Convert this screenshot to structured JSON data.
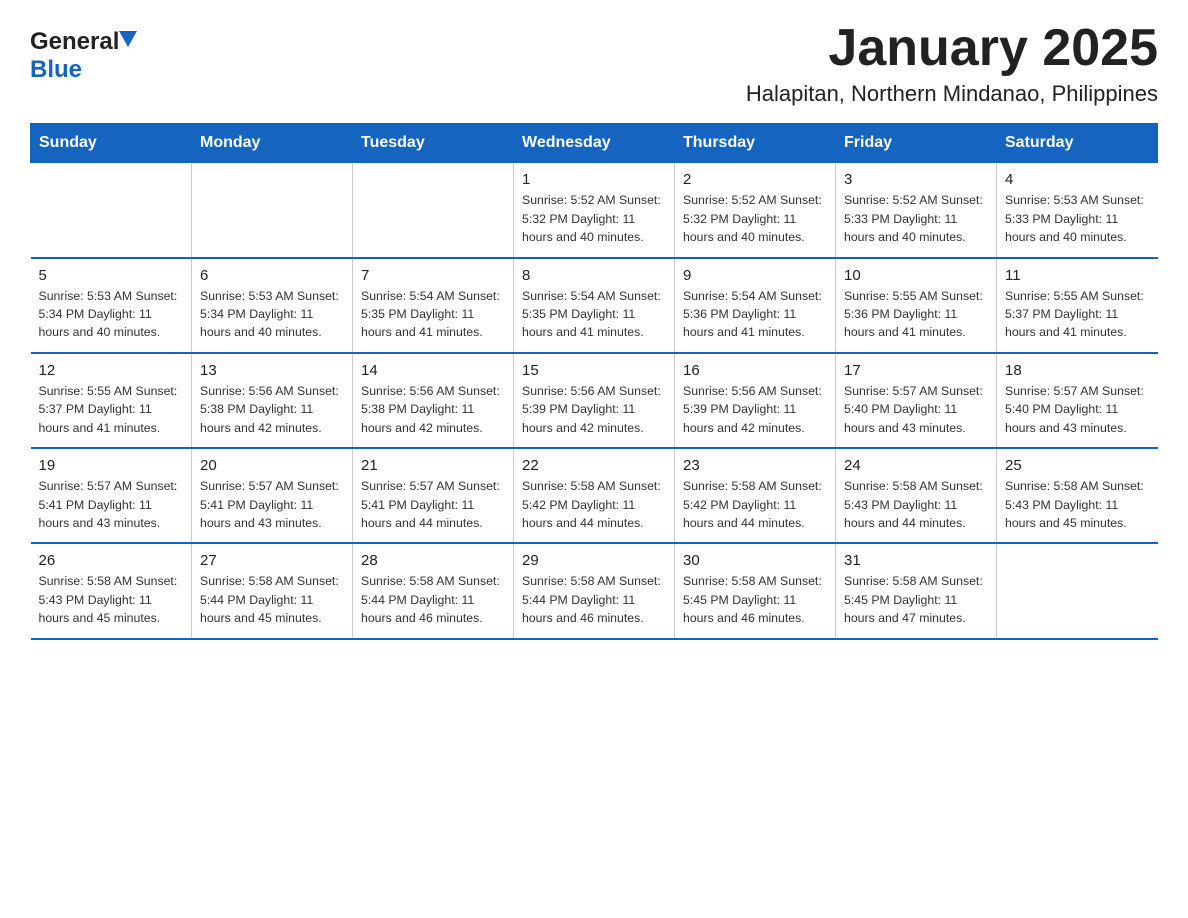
{
  "logo": {
    "general": "General",
    "blue": "Blue"
  },
  "title": "January 2025",
  "subtitle": "Halapitan, Northern Mindanao, Philippines",
  "days_of_week": [
    "Sunday",
    "Monday",
    "Tuesday",
    "Wednesday",
    "Thursday",
    "Friday",
    "Saturday"
  ],
  "weeks": [
    [
      {
        "day": "",
        "info": ""
      },
      {
        "day": "",
        "info": ""
      },
      {
        "day": "",
        "info": ""
      },
      {
        "day": "1",
        "info": "Sunrise: 5:52 AM\nSunset: 5:32 PM\nDaylight: 11 hours and 40 minutes."
      },
      {
        "day": "2",
        "info": "Sunrise: 5:52 AM\nSunset: 5:32 PM\nDaylight: 11 hours and 40 minutes."
      },
      {
        "day": "3",
        "info": "Sunrise: 5:52 AM\nSunset: 5:33 PM\nDaylight: 11 hours and 40 minutes."
      },
      {
        "day": "4",
        "info": "Sunrise: 5:53 AM\nSunset: 5:33 PM\nDaylight: 11 hours and 40 minutes."
      }
    ],
    [
      {
        "day": "5",
        "info": "Sunrise: 5:53 AM\nSunset: 5:34 PM\nDaylight: 11 hours and 40 minutes."
      },
      {
        "day": "6",
        "info": "Sunrise: 5:53 AM\nSunset: 5:34 PM\nDaylight: 11 hours and 40 minutes."
      },
      {
        "day": "7",
        "info": "Sunrise: 5:54 AM\nSunset: 5:35 PM\nDaylight: 11 hours and 41 minutes."
      },
      {
        "day": "8",
        "info": "Sunrise: 5:54 AM\nSunset: 5:35 PM\nDaylight: 11 hours and 41 minutes."
      },
      {
        "day": "9",
        "info": "Sunrise: 5:54 AM\nSunset: 5:36 PM\nDaylight: 11 hours and 41 minutes."
      },
      {
        "day": "10",
        "info": "Sunrise: 5:55 AM\nSunset: 5:36 PM\nDaylight: 11 hours and 41 minutes."
      },
      {
        "day": "11",
        "info": "Sunrise: 5:55 AM\nSunset: 5:37 PM\nDaylight: 11 hours and 41 minutes."
      }
    ],
    [
      {
        "day": "12",
        "info": "Sunrise: 5:55 AM\nSunset: 5:37 PM\nDaylight: 11 hours and 41 minutes."
      },
      {
        "day": "13",
        "info": "Sunrise: 5:56 AM\nSunset: 5:38 PM\nDaylight: 11 hours and 42 minutes."
      },
      {
        "day": "14",
        "info": "Sunrise: 5:56 AM\nSunset: 5:38 PM\nDaylight: 11 hours and 42 minutes."
      },
      {
        "day": "15",
        "info": "Sunrise: 5:56 AM\nSunset: 5:39 PM\nDaylight: 11 hours and 42 minutes."
      },
      {
        "day": "16",
        "info": "Sunrise: 5:56 AM\nSunset: 5:39 PM\nDaylight: 11 hours and 42 minutes."
      },
      {
        "day": "17",
        "info": "Sunrise: 5:57 AM\nSunset: 5:40 PM\nDaylight: 11 hours and 43 minutes."
      },
      {
        "day": "18",
        "info": "Sunrise: 5:57 AM\nSunset: 5:40 PM\nDaylight: 11 hours and 43 minutes."
      }
    ],
    [
      {
        "day": "19",
        "info": "Sunrise: 5:57 AM\nSunset: 5:41 PM\nDaylight: 11 hours and 43 minutes."
      },
      {
        "day": "20",
        "info": "Sunrise: 5:57 AM\nSunset: 5:41 PM\nDaylight: 11 hours and 43 minutes."
      },
      {
        "day": "21",
        "info": "Sunrise: 5:57 AM\nSunset: 5:41 PM\nDaylight: 11 hours and 44 minutes."
      },
      {
        "day": "22",
        "info": "Sunrise: 5:58 AM\nSunset: 5:42 PM\nDaylight: 11 hours and 44 minutes."
      },
      {
        "day": "23",
        "info": "Sunrise: 5:58 AM\nSunset: 5:42 PM\nDaylight: 11 hours and 44 minutes."
      },
      {
        "day": "24",
        "info": "Sunrise: 5:58 AM\nSunset: 5:43 PM\nDaylight: 11 hours and 44 minutes."
      },
      {
        "day": "25",
        "info": "Sunrise: 5:58 AM\nSunset: 5:43 PM\nDaylight: 11 hours and 45 minutes."
      }
    ],
    [
      {
        "day": "26",
        "info": "Sunrise: 5:58 AM\nSunset: 5:43 PM\nDaylight: 11 hours and 45 minutes."
      },
      {
        "day": "27",
        "info": "Sunrise: 5:58 AM\nSunset: 5:44 PM\nDaylight: 11 hours and 45 minutes."
      },
      {
        "day": "28",
        "info": "Sunrise: 5:58 AM\nSunset: 5:44 PM\nDaylight: 11 hours and 46 minutes."
      },
      {
        "day": "29",
        "info": "Sunrise: 5:58 AM\nSunset: 5:44 PM\nDaylight: 11 hours and 46 minutes."
      },
      {
        "day": "30",
        "info": "Sunrise: 5:58 AM\nSunset: 5:45 PM\nDaylight: 11 hours and 46 minutes."
      },
      {
        "day": "31",
        "info": "Sunrise: 5:58 AM\nSunset: 5:45 PM\nDaylight: 11 hours and 47 minutes."
      },
      {
        "day": "",
        "info": ""
      }
    ]
  ]
}
